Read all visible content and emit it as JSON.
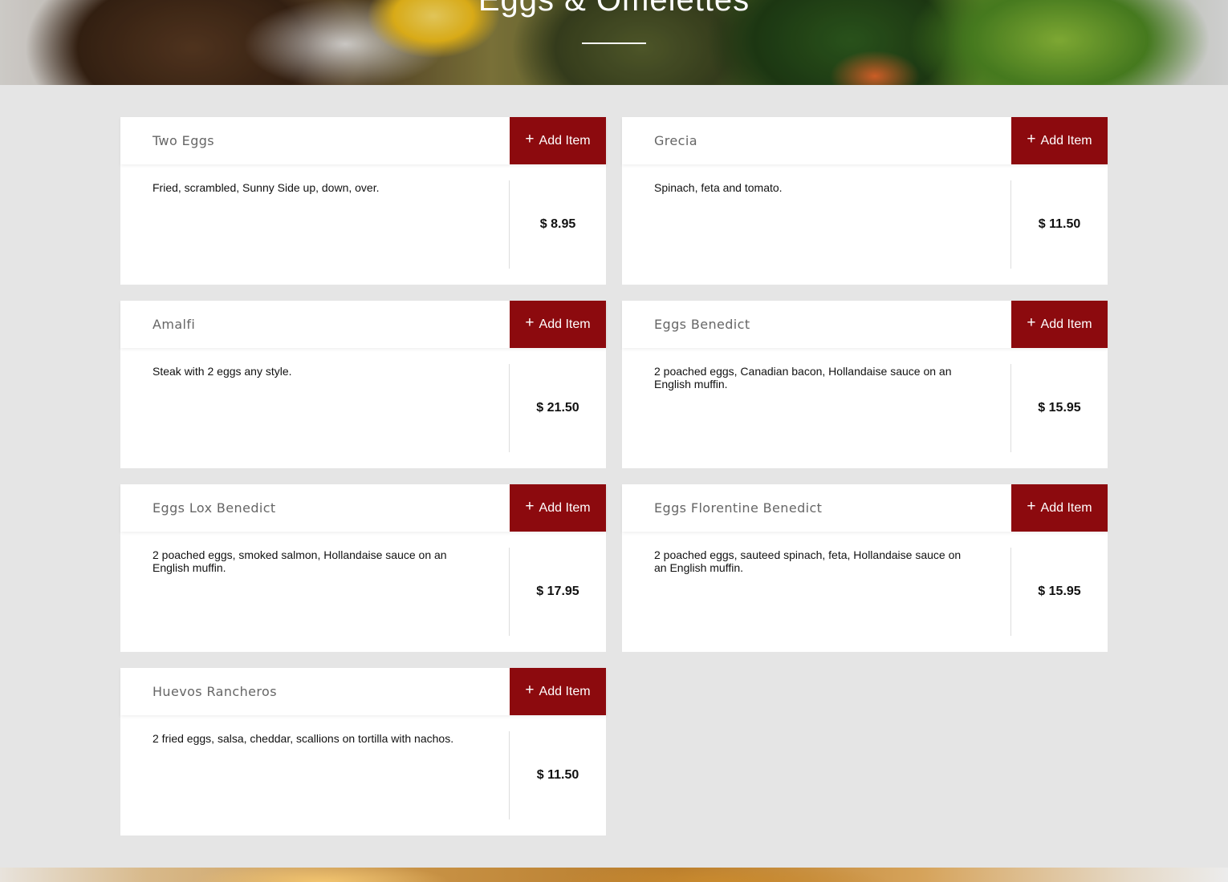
{
  "hero": {
    "title": "Eggs & Omelettes"
  },
  "button_label": "Add Item",
  "plus_glyph": "+",
  "accent_color": "#8c0a0e",
  "items": [
    {
      "name": "Two Eggs",
      "description": "Fried, scrambled, Sunny Side up, down, over.",
      "price": "$ 8.95"
    },
    {
      "name": "Grecia",
      "description": "Spinach, feta and tomato.",
      "price": "$ 11.50"
    },
    {
      "name": "Amalfi",
      "description": "Steak with 2 eggs any style.",
      "price": "$ 21.50"
    },
    {
      "name": "Eggs Benedict",
      "description": "2 poached eggs, Canadian bacon, Hollandaise sauce on an English muffin.",
      "price": "$ 15.95"
    },
    {
      "name": "Eggs Lox Benedict",
      "description": "2 poached eggs, smoked salmon, Hollandaise sauce on an English muffin.",
      "price": "$ 17.95"
    },
    {
      "name": "Eggs Florentine Benedict",
      "description": "2 poached eggs, sauteed spinach, feta, Hollandaise sauce on an English muffin.",
      "price": "$ 15.95"
    },
    {
      "name": "Huevos Rancheros",
      "description": "2 fried eggs, salsa, cheddar, scallions on tortilla with nachos.",
      "price": "$ 11.50"
    }
  ]
}
